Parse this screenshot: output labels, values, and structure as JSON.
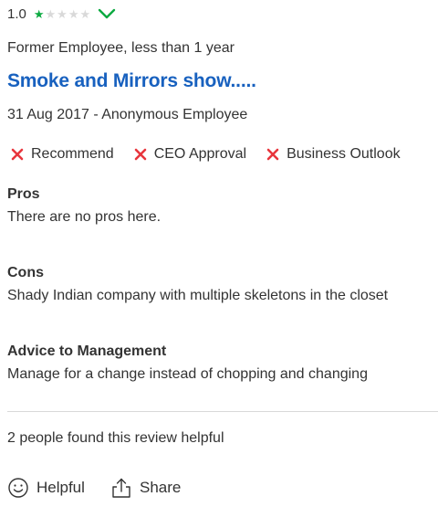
{
  "rating": {
    "value": "1.0",
    "stars_filled": 1,
    "stars_total": 5
  },
  "reviewer": {
    "job": "Former Employee, less than 1 year"
  },
  "review": {
    "title": "Smoke and Mirrors show.....",
    "meta": "31 Aug 2017 - Anonymous Employee"
  },
  "flags": [
    {
      "label": "Recommend",
      "status": "no"
    },
    {
      "label": "CEO Approval",
      "status": "no"
    },
    {
      "label": "Business Outlook",
      "status": "no"
    }
  ],
  "sections": {
    "pros": {
      "heading": "Pros",
      "text": "There are no pros here."
    },
    "cons": {
      "heading": "Cons",
      "text": "Shady Indian company with multiple skeletons in the closet"
    },
    "advice": {
      "heading": "Advice to Management",
      "text": "Manage for a change instead of chopping and changing"
    }
  },
  "helpful_count_text": "2 people found this review helpful",
  "actions": {
    "helpful_label": "Helpful",
    "share_label": "Share"
  },
  "colors": {
    "accent_green": "#0caa41",
    "title_blue": "#1861bf",
    "negative_red": "#e8353c"
  },
  "icons": {
    "expand": "chevron-down-icon",
    "negative": "x-icon",
    "helpful": "smiley-icon",
    "share": "share-icon"
  }
}
